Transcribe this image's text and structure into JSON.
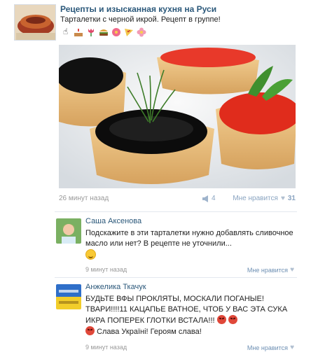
{
  "post": {
    "author": "Рецепты и изысканная кухня на Руси",
    "text": "Тарталетки с черной икрой. Рецепт в группе!",
    "emojis": [
      "hand-point-icon",
      "cake-icon",
      "tulip-icon",
      "burger-icon",
      "flower-icon",
      "pizza-icon",
      "blossom-icon"
    ],
    "time": "26 минут назад",
    "reposts": "4",
    "like_label": "Мне нравится",
    "like_count": "31"
  },
  "comments": [
    {
      "name": "Саша Аксенова",
      "text": "Подскажите в эти тарталетки нужно добавлять сливочное масло или нет? В рецепте не уточнили...",
      "time": "9 минут назад",
      "like_label": "Мне нравится"
    },
    {
      "name": "Анжелика Ткачук",
      "text_1": "БУДЬТЕ ВФЫ ПРОКЛЯТЫ, МОСКАЛИ ПОГАНЫЕ! ТВАРИ!!!!11 КАЦАПЬЕ ВАТНОЕ, ЧТОБ У ВАС ЭТА СУКА ИКРА ПОПЕРЕК ГЛОТКИ ВСТАЛА!!!",
      "text_2": "Слава Україні! Героям слава!",
      "time": "9 минут назад",
      "like_label": "Мне нравится"
    }
  ],
  "colors": {
    "link": "#2b587a",
    "meta": "#999999",
    "accent": "#8aa4c1"
  }
}
